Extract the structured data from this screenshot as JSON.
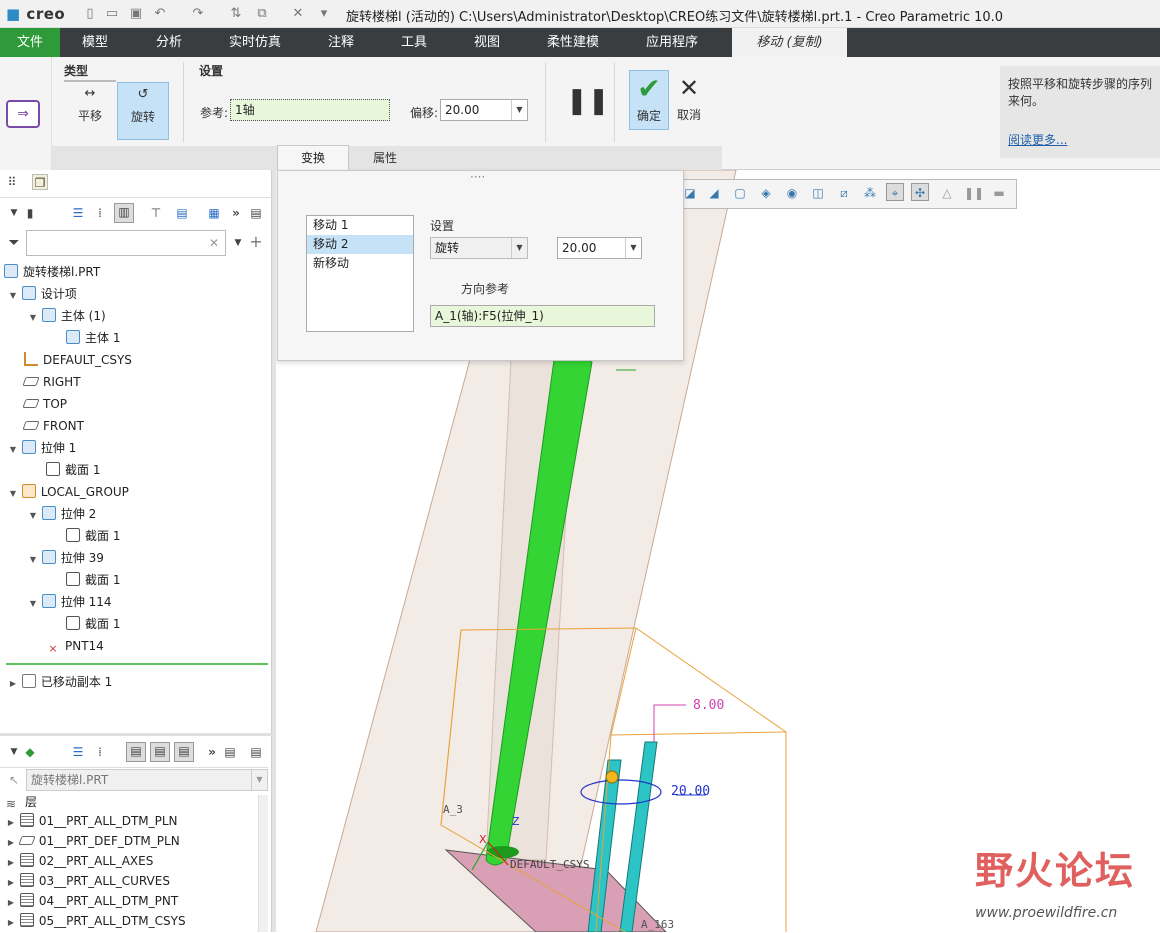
{
  "titlebar": {
    "app_logo": "creo",
    "window_title": "旋转楼梯l (活动的) C:\\Users\\Administrator\\Desktop\\CREO练习文件\\旋转楼梯l.prt.1 - Creo Parametric 10.0"
  },
  "menubar": {
    "file": "文件",
    "items": [
      "模型",
      "分析",
      "实时仿真",
      "注释",
      "工具",
      "视图",
      "柔性建模",
      "应用程序"
    ],
    "active_tab": "移动 (复制)"
  },
  "ribbon": {
    "type_group_label": "类型",
    "translate_label": "平移",
    "rotate_label": "旋转",
    "settings_group_label": "设置",
    "reference_label": "参考:",
    "reference_value": "1轴",
    "offset_label": "偏移:",
    "offset_value": "20.00",
    "confirm_label": "确定",
    "cancel_label": "取消",
    "subtabs": [
      "变换",
      "属性"
    ],
    "help_text": "按照平移和旋转步骤的序列来何。",
    "help_link": "阅读更多..."
  },
  "transform_panel": {
    "moves": [
      "移动 1",
      "移动 2",
      "新移动"
    ],
    "selected_index": 1,
    "settings_label": "设置",
    "type_value": "旋转",
    "value": "20.00",
    "direction_ref_label": "方向参考",
    "direction_ref_value": "A_1(轴):F5(拉伸_1)"
  },
  "model_tree": {
    "filter_placeholder": "",
    "items": [
      {
        "label": "旋转楼梯l.PRT",
        "icon": "part-icon"
      },
      {
        "label": "设计项",
        "icon": "design-items-icon"
      },
      {
        "label": "主体 (1)",
        "icon": "body-icon"
      },
      {
        "label": "主体 1",
        "icon": "body-icon"
      },
      {
        "label": "DEFAULT_CSYS",
        "icon": "csys-icon"
      },
      {
        "label": "RIGHT",
        "icon": "plane-icon"
      },
      {
        "label": "TOP",
        "icon": "plane-icon"
      },
      {
        "label": "FRONT",
        "icon": "plane-icon"
      },
      {
        "label": "拉伸 1",
        "icon": "extrude-icon"
      },
      {
        "label": "截面 1",
        "icon": "sketch-icon"
      },
      {
        "label": "LOCAL_GROUP",
        "icon": "group-icon"
      },
      {
        "label": "拉伸 2",
        "icon": "extrude-icon"
      },
      {
        "label": "截面 1",
        "icon": "sketch-icon"
      },
      {
        "label": "拉伸 39",
        "icon": "extrude-icon"
      },
      {
        "label": "截面 1",
        "icon": "sketch-icon"
      },
      {
        "label": "拉伸 114",
        "icon": "extrude-icon"
      },
      {
        "label": "截面 1",
        "icon": "sketch-icon"
      },
      {
        "label": "PNT14",
        "icon": "point-icon"
      },
      {
        "label": "已移动副本 1",
        "icon": "moved-copy-icon"
      }
    ]
  },
  "layer_tree": {
    "part_name": "旋转楼梯l.PRT",
    "header": "层",
    "layers": [
      "01__PRT_ALL_DTM_PLN",
      "01__PRT_DEF_DTM_PLN",
      "02__PRT_ALL_AXES",
      "03__PRT_ALL_CURVES",
      "04__PRT_ALL_DTM_PNT",
      "05__PRT_ALL_DTM_CSYS"
    ]
  },
  "viewport": {
    "dim_1": "8.00",
    "dim_2": "20.00",
    "axis_label": "A_3",
    "csys_label": "DEFAULT_CSYS",
    "x_label": "X",
    "z_label": "Z",
    "bottom_label": "A_163"
  },
  "watermark": {
    "text": "野火论坛",
    "url": "www.proewildfire.cn"
  },
  "colors": {
    "menu_bg": "#3a3d3f",
    "file_tab": "#2f9a3a",
    "selected": "#c5e2f7",
    "ref_field": "#e8f6d9",
    "rod": "#2fd12f",
    "bbox": "#e8a23a"
  }
}
